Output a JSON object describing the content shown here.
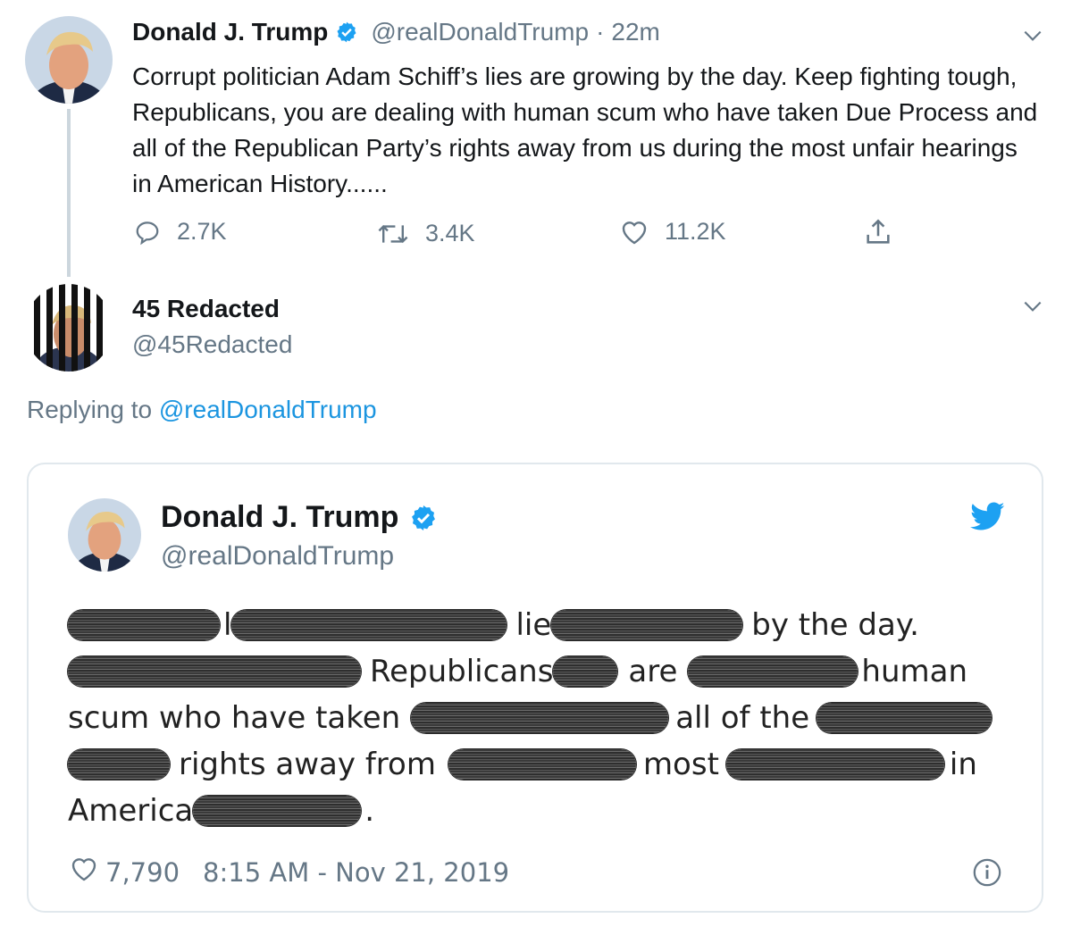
{
  "tweet": {
    "author_name": "Donald J. Trump",
    "handle": "@realDonaldTrump",
    "separator": "·",
    "time": "22m",
    "text": "Corrupt politician Adam Schiff’s lies are growing by the day. Keep fighting tough, Republicans, you are dealing with human scum who have taken Due Process and all of the Republican Party’s rights away from us during the most unfair hearings in American History......",
    "actions": {
      "reply_count": "2.7K",
      "retweet_count": "3.4K",
      "like_count": "11.2K"
    }
  },
  "reply": {
    "author_name": "45 Redacted",
    "handle": "@45Redacted",
    "replying_prefix": "Replying to",
    "replying_to": "@realDonaldTrump"
  },
  "embedded_card": {
    "author_name": "Donald J. Trump",
    "handle": "@realDonaldTrump",
    "lines": [
      [
        "l",
        "lie",
        "by the day."
      ],
      [
        "Republicans",
        "are",
        "human"
      ],
      [
        "scum who have taken",
        "all of the"
      ],
      [
        "rights away from",
        "most",
        "in"
      ],
      [
        "America",
        "."
      ]
    ],
    "like_count": "7,790",
    "timestamp": "8:15 AM - Nov 21, 2019"
  },
  "colors": {
    "accent": "#1da1f2",
    "link": "#1b95e0",
    "muted": "#657786",
    "border": "#e1e8ed"
  },
  "icons": [
    "verified-badge-icon",
    "chevron-down-icon",
    "reply-icon",
    "retweet-icon",
    "like-icon",
    "share-icon",
    "twitter-bird-icon",
    "info-icon"
  ]
}
